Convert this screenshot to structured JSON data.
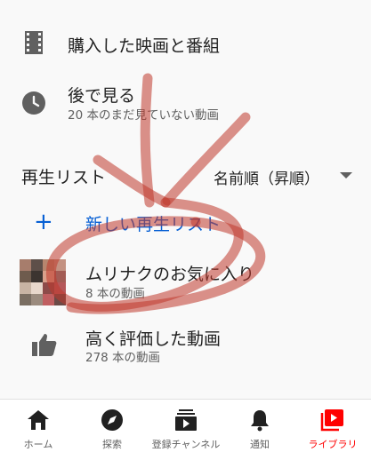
{
  "library": {
    "purchased": {
      "title": "購入した映画と番組"
    },
    "watch_later": {
      "title": "後で見る",
      "subtitle": "20 本のまだ見ていない動画"
    },
    "playlists": {
      "header": "再生リスト",
      "sort_label": "名前順（昇順）",
      "new_playlist": "新しい再生リスト",
      "items": [
        {
          "title": "ムリナクのお気に入り",
          "subtitle": "8 本の動画"
        },
        {
          "title": "高く評価した動画",
          "subtitle": "278 本の動画"
        }
      ]
    }
  },
  "bottom_nav": {
    "items": [
      {
        "label": "ホーム",
        "icon": "home-icon"
      },
      {
        "label": "探索",
        "icon": "explore-icon"
      },
      {
        "label": "登録チャンネル",
        "icon": "subscriptions-icon"
      },
      {
        "label": "通知",
        "icon": "bell-icon"
      },
      {
        "label": "ライブラリ",
        "icon": "library-icon",
        "active": true
      }
    ]
  },
  "colors": {
    "link_blue": "#065fd4",
    "active_red": "#ff0000",
    "annotation_red": "#c0392b"
  }
}
